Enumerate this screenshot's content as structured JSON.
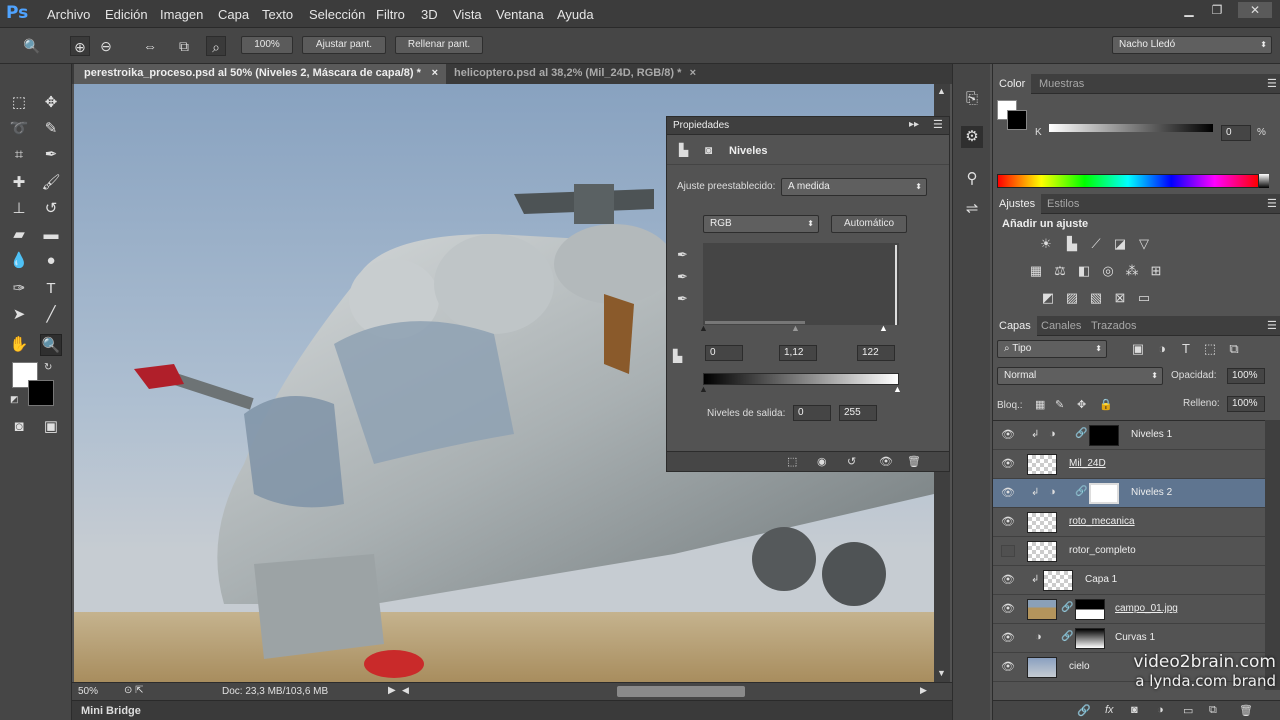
{
  "app": {
    "logo": "Ps"
  },
  "menu": [
    "Archivo",
    "Edición",
    "Imagen",
    "Capa",
    "Texto",
    "Selección",
    "Filtro",
    "3D",
    "Vista",
    "Ventana",
    "Ayuda"
  ],
  "options_bar": {
    "zoom_value": "100%",
    "fit_button": "Ajustar pant.",
    "fill_button": "Rellenar pant.",
    "workspace": "Nacho Lledó"
  },
  "tabs": [
    {
      "label": "perestroika_proceso.psd al 50% (Niveles 2, Máscara de capa/8) *",
      "close": "×"
    },
    {
      "label": "helicoptero.psd al 38,2% (Mil_24D, RGB/8) *",
      "close": "×"
    }
  ],
  "status": {
    "zoom": "50%",
    "doc": "Doc: 23,3 MB/103,6 MB"
  },
  "mini_bridge": "Mini Bridge",
  "properties": {
    "title": "Propiedades",
    "adjustment_name": "Niveles",
    "preset_label": "Ajuste preestablecido:",
    "preset_value": "A medida",
    "channel": "RGB",
    "auto_button": "Automático",
    "input_black": "0",
    "input_gamma": "1,12",
    "input_white": "122",
    "output_label": "Niveles de salida:",
    "output_black": "0",
    "output_white": "255"
  },
  "color_panel": {
    "tabs": [
      "Color",
      "Muestras"
    ],
    "channel_label": "K",
    "value": "0",
    "unit": "%"
  },
  "adjustments_panel": {
    "tabs": [
      "Ajustes",
      "Estilos"
    ],
    "heading": "Añadir un ajuste"
  },
  "layers_panel": {
    "tabs": [
      "Capas",
      "Canales",
      "Trazados"
    ],
    "filter": "Tipo",
    "blend_mode": "Normal",
    "opacity_label": "Opacidad:",
    "opacity": "100%",
    "lock_label": "Bloq.:",
    "fill_label": "Relleno:",
    "fill": "100%",
    "layers": [
      {
        "name": "Niveles 1"
      },
      {
        "name": "Mil_24D"
      },
      {
        "name": "Niveles 2"
      },
      {
        "name": "roto_mecanica"
      },
      {
        "name": "rotor_completo"
      },
      {
        "name": "Capa 1"
      },
      {
        "name": "campo_01.jpg"
      },
      {
        "name": "Curvas 1"
      },
      {
        "name": "cielo"
      }
    ]
  },
  "watermark": {
    "line1": "video2brain.com",
    "line2": "a lynda.com brand"
  },
  "colors": {
    "ps_blue": "#4fa3ff",
    "selected_layer": "#5f7590"
  }
}
